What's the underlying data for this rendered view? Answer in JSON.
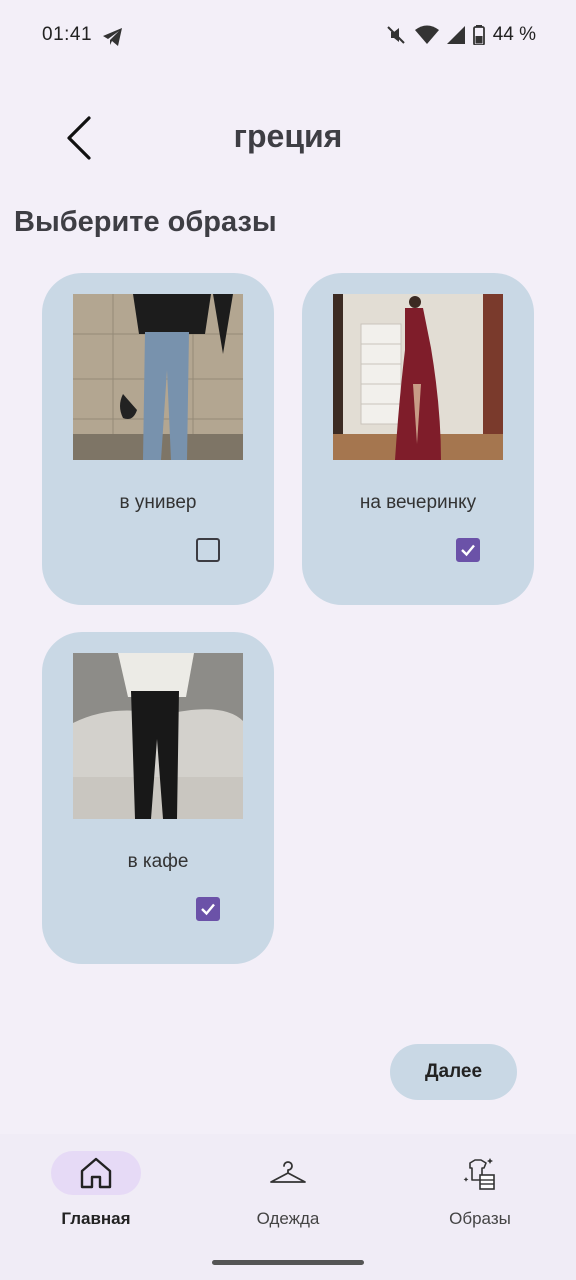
{
  "status_bar": {
    "time": "01:41",
    "battery": "44 %",
    "icons": [
      "telegram-icon",
      "mute-icon",
      "wifi-icon",
      "signal-icon",
      "battery-icon"
    ]
  },
  "header": {
    "title": "греция",
    "back_icon": "chevron-left-icon"
  },
  "section": {
    "heading": "Выберите образы"
  },
  "cards": [
    {
      "label": "в универ",
      "checked": false,
      "image": "outfit-jeans-photo"
    },
    {
      "label": "на вечеринку",
      "checked": true,
      "image": "outfit-red-dress-photo"
    },
    {
      "label": "в кафе",
      "checked": true,
      "image": "outfit-leather-pants-photo"
    }
  ],
  "actions": {
    "next_label": "Далее"
  },
  "bottom_nav": {
    "items": [
      {
        "label": "Главная",
        "icon": "home-icon",
        "active": true
      },
      {
        "label": "Одежда",
        "icon": "hanger-icon",
        "active": false
      },
      {
        "label": "Образы",
        "icon": "outfits-icon",
        "active": false
      }
    ]
  },
  "colors": {
    "background": "#f3eff8",
    "card": "#c9d8e5",
    "accent": "#6b52a8",
    "nav_active_pill": "#e6daf6"
  }
}
